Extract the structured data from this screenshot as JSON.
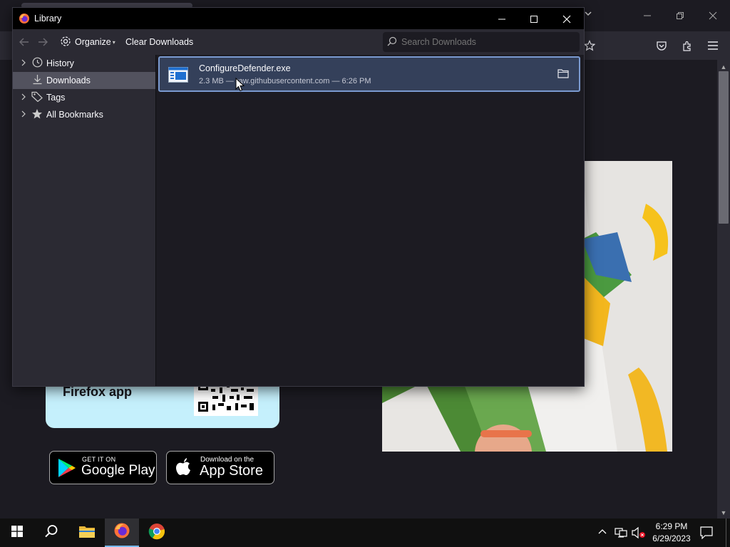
{
  "library": {
    "title": "Library",
    "organize_label": "Organize",
    "clear_label": "Clear Downloads",
    "search_placeholder": "Search Downloads",
    "sidebar": [
      {
        "label": "History",
        "icon": "clock-icon",
        "expandable": true,
        "selected": false
      },
      {
        "label": "Downloads",
        "icon": "download-icon",
        "expandable": false,
        "selected": true
      },
      {
        "label": "Tags",
        "icon": "tag-icon",
        "expandable": true,
        "selected": false
      },
      {
        "label": "All Bookmarks",
        "icon": "star-icon",
        "expandable": true,
        "selected": false
      }
    ],
    "downloads": [
      {
        "filename": "ConfigureDefender.exe",
        "details": "2.3 MB — raw.githubusercontent.com — 6:26 PM"
      }
    ]
  },
  "page": {
    "promo_text": "Firefox app",
    "google_play_small": "GET IT ON",
    "google_play_big": "Google Play",
    "app_store_small": "Download on the",
    "app_store_big": "App Store"
  },
  "taskbar": {
    "time": "6:29 PM",
    "date": "6/29/2023"
  },
  "colors": {
    "accent_selection": "#7a9ad0",
    "promo_bg": "#c5f0fc"
  }
}
